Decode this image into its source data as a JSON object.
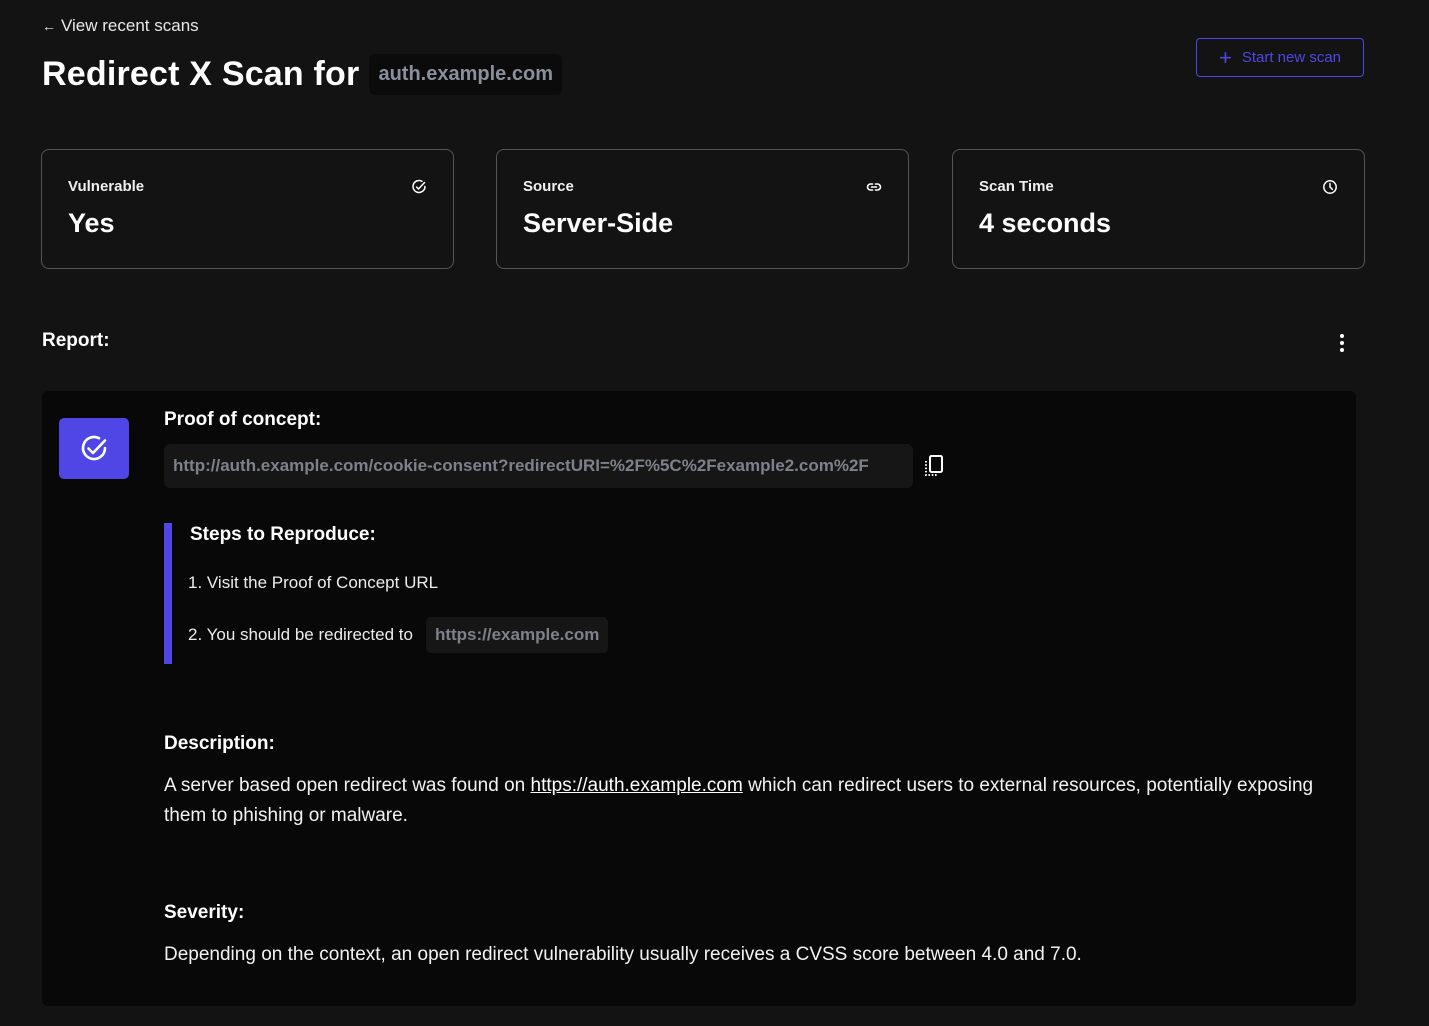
{
  "nav": {
    "back_arrow": "←",
    "back_label": "View recent scans"
  },
  "header": {
    "title": "Redirect X Scan for",
    "domain": "auth.example.com",
    "start_button_icon": "+",
    "start_button_label": "Start new scan"
  },
  "stats": [
    {
      "label": "Vulnerable",
      "value": "Yes",
      "icon": "check-circle-icon"
    },
    {
      "label": "Source",
      "value": "Server-Side",
      "icon": "link-icon"
    },
    {
      "label": "Scan Time",
      "value": "4 seconds",
      "icon": "clock-icon"
    }
  ],
  "report": {
    "label": "Report:",
    "menu_icon": "more-vertical-icon",
    "status_icon": "check-circle-icon",
    "proof_heading": "Proof of concept:",
    "proof_url": "http://auth.example.com/cookie-consent?redirectURI=%2F%5C%2Fexample2.com%2F",
    "copy_icon": "copy-icon",
    "steps_heading": "Steps to Reproduce:",
    "steps": [
      {
        "text": "1. Visit the Proof of Concept URL"
      },
      {
        "text": "2. You should be redirected to",
        "chip": "https://example.com"
      }
    ],
    "description_heading": "Description:",
    "description_before": "A server based open redirect was found on ",
    "description_link": "https://auth.example.com",
    "description_after": " which can redirect users to external resources, potentially exposing them to phishing or malware.",
    "severity_heading": "Severity:",
    "severity_text": "Depending on the context, an open redirect vulnerability usually receives a CVSS score between 4.0 and 7.0."
  },
  "colors": {
    "accent": "#4f46e5",
    "background": "#131313",
    "panel": "#080808",
    "chip_text": "#7d818c"
  }
}
